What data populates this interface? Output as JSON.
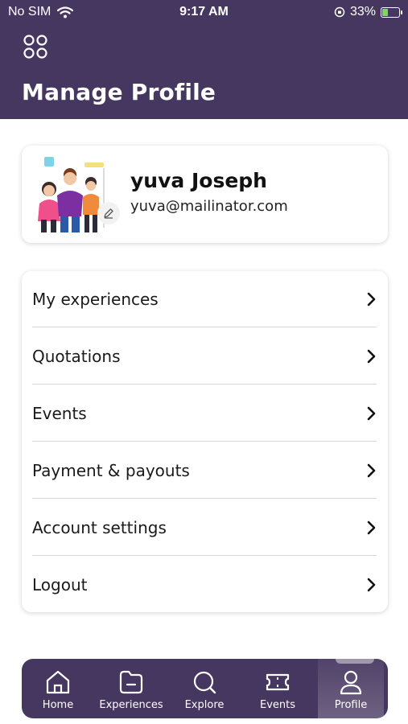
{
  "status_bar": {
    "carrier": "No SIM",
    "time": "9:17 AM",
    "battery": "33%"
  },
  "header": {
    "title": "Manage Profile",
    "menu_icon": "grid-icon"
  },
  "profile": {
    "name": "yuva Joseph",
    "email": "yuva@mailinator.com",
    "edit_icon": "pencil-icon"
  },
  "menu": {
    "items": [
      {
        "label": "My experiences"
      },
      {
        "label": "Quotations"
      },
      {
        "label": "Events"
      },
      {
        "label": "Payment & payouts"
      },
      {
        "label": "Account settings"
      },
      {
        "label": "Logout"
      }
    ]
  },
  "bottom_nav": {
    "items": [
      {
        "label": "Home",
        "icon": "home-icon"
      },
      {
        "label": "Experiences",
        "icon": "folder-icon"
      },
      {
        "label": "Explore",
        "icon": "search-icon"
      },
      {
        "label": "Events",
        "icon": "ticket-icon"
      },
      {
        "label": "Profile",
        "icon": "user-icon"
      }
    ],
    "active": "Profile"
  },
  "colors": {
    "primary": "#463760",
    "background": "#ffffff",
    "text": "#1a1a1a"
  }
}
